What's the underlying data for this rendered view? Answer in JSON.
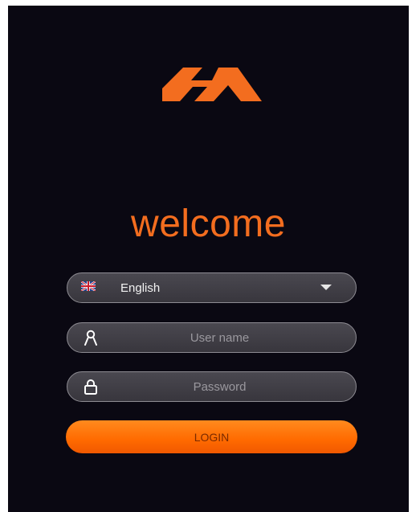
{
  "brand": {
    "logo_icon": "mm-logo-icon",
    "accent_color": "#f36d1f",
    "background_color": "#0a0812"
  },
  "welcome_text": "welcome",
  "language": {
    "flag_icon": "uk-flag-icon",
    "selected": "English",
    "dropdown_icon": "caret-down-icon"
  },
  "username": {
    "icon": "user-icon",
    "placeholder": "User name",
    "value": ""
  },
  "password": {
    "icon": "lock-icon",
    "placeholder": "Password",
    "value": ""
  },
  "login_label": "LOGIN"
}
